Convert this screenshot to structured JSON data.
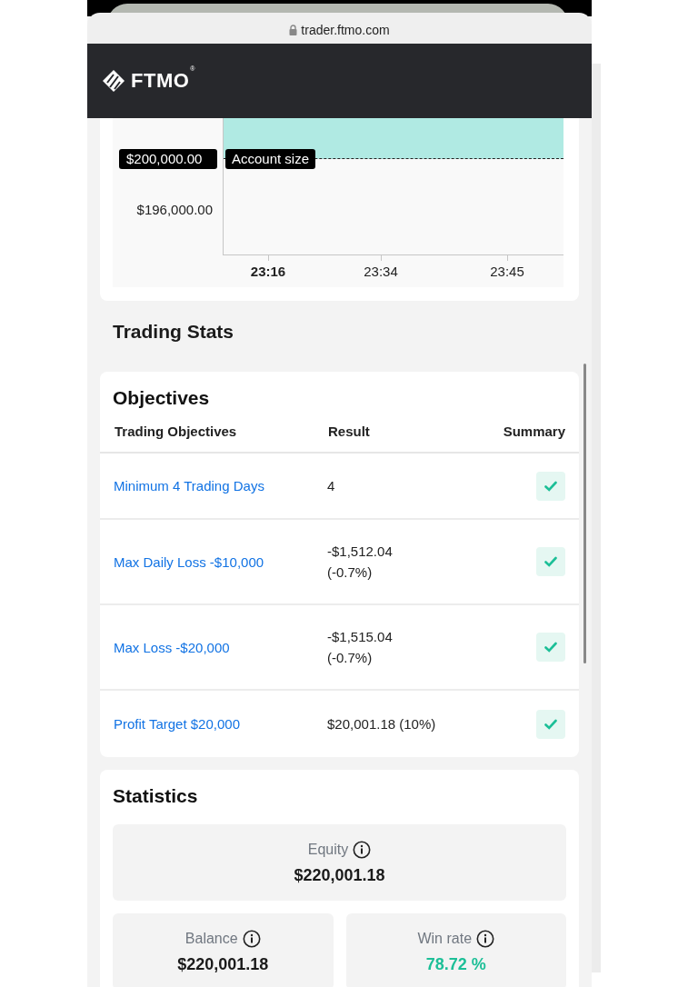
{
  "browser": {
    "url": "trader.ftmo.com"
  },
  "header": {
    "logo_text": "FTMO",
    "logo_mark": "®"
  },
  "chart": {
    "y_label": "$196,000.00",
    "account_size": {
      "value": "$200,000.00",
      "label": "Account size"
    },
    "x_labels": [
      {
        "label": "23:16",
        "selected": true
      },
      {
        "label": "23:34",
        "selected": false
      },
      {
        "label": "23:45",
        "selected": false
      }
    ]
  },
  "section_title": "Trading Stats",
  "objectives": {
    "title": "Objectives",
    "columns": [
      "Trading Objectives",
      "Result",
      "Summary"
    ],
    "rows": [
      {
        "name": "Minimum 4 Trading Days",
        "result": [
          "4"
        ],
        "passed": true
      },
      {
        "name": "Max Daily Loss -$10,000",
        "result": [
          "-$1,512.04",
          "(-0.7%)"
        ],
        "passed": true
      },
      {
        "name": "Max Loss -$20,000",
        "result": [
          "-$1,515.04",
          "(-0.7%)"
        ],
        "passed": true
      },
      {
        "name": "Profit Target $20,000",
        "result": [
          "$20,001.18 (10%)"
        ],
        "passed": true
      }
    ]
  },
  "statistics": {
    "title": "Statistics",
    "cards": [
      {
        "label": "Equity",
        "value": "$220,001.18",
        "wide": true,
        "highlight": false
      },
      {
        "label": "Balance",
        "value": "$220,001.18",
        "wide": false,
        "highlight": false
      },
      {
        "label": "Win rate",
        "value": "78.72 %",
        "wide": false,
        "highlight": true
      }
    ]
  }
}
